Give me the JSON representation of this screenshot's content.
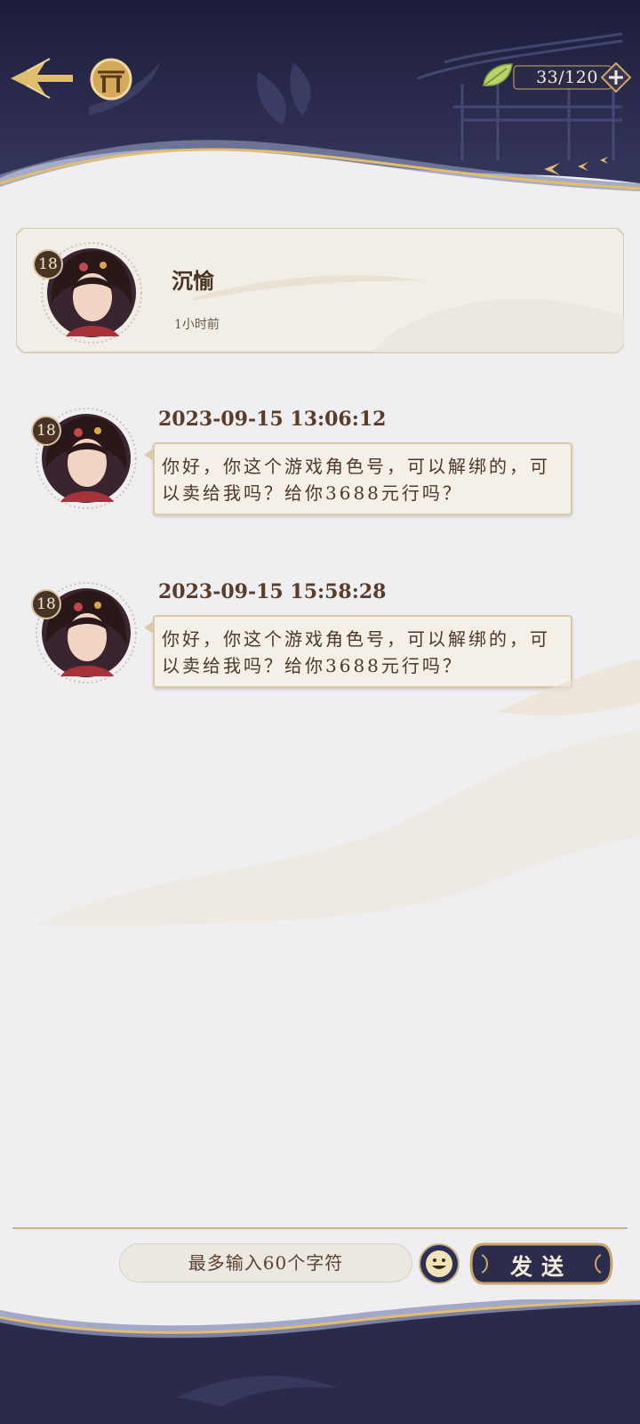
{
  "header": {
    "stamina": "33/120",
    "colors": {
      "night": "#262747",
      "gold": "#e1bd70",
      "cream": "#efeff2"
    },
    "icons": [
      "back-arrow-icon",
      "home-gate-icon",
      "leaf-icon",
      "plus-icon"
    ]
  },
  "contact": {
    "name": "沉愉",
    "time": "1小时前",
    "level": "18"
  },
  "messages": [
    {
      "level": "18",
      "time": "2023-09-15 13:06:12",
      "text": "你好，你这个游戏角色号，可以解绑的，可以卖给我吗？给你3688元行吗？"
    },
    {
      "level": "18",
      "time": "2023-09-15 15:58:28",
      "text": "你好，你这个游戏角色号，可以解绑的，可以卖给我吗？给你3688元行吗？"
    }
  ],
  "composer": {
    "placeholder": "最多输入60个字符",
    "send_label": "发送"
  }
}
